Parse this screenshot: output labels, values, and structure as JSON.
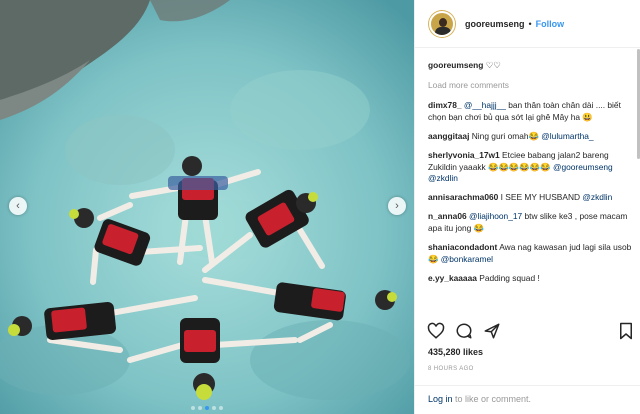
{
  "post": {
    "username": "gooreumseng",
    "follow_label": "Follow",
    "separator": "•",
    "caption_text": "♡♡",
    "load_more": "Load more comments",
    "comments": [
      {
        "user": "dimx78_",
        "parts": [
          {
            "t": " "
          },
          {
            "t": "@__hajjj__",
            "m": true
          },
          {
            "t": " ban thân toàn chân dài .... biết chọn bạn chơi bủ qua sớt lại ghê Mây ha 😃"
          }
        ]
      },
      {
        "user": "aanggitaaj",
        "parts": [
          {
            "t": " Ning guri omah😂 "
          },
          {
            "t": "@lulumartha_",
            "m": true
          }
        ]
      },
      {
        "user": "sherlyvonia_17w1",
        "parts": [
          {
            "t": " Etciee babang jalan2 bareng Zukildin yaaakk 😂😂😂😂😂😂 "
          },
          {
            "t": "@gooreumseng",
            "m": true
          },
          {
            "t": " "
          },
          {
            "t": "@zkdlin",
            "m": true
          }
        ]
      },
      {
        "user": "annisarachma060",
        "parts": [
          {
            "t": " I SEE MY HUSBAND "
          },
          {
            "t": "@zkdlin",
            "m": true
          }
        ]
      },
      {
        "user": "n_anna06",
        "parts": [
          {
            "t": " "
          },
          {
            "t": "@liajihoon_17",
            "m": true
          },
          {
            "t": " btw slike ke3 , pose macam apa itu jong 😂"
          }
        ]
      },
      {
        "user": "shaniacondadont",
        "parts": [
          {
            "t": " Awa nag kawasan jud lagi sila usob 😂 "
          },
          {
            "t": "@bonkaramel",
            "m": true
          }
        ]
      },
      {
        "user": "e.yy_kaaaaa",
        "parts": [
          {
            "t": " Padding squad !"
          }
        ]
      }
    ],
    "likes": "435,280 likes",
    "timestamp": "8 HOURS AGO",
    "login_link": "Log in",
    "login_rest": " to like or comment.",
    "icons": [
      "heart-icon",
      "comment-icon",
      "share-icon",
      "bookmark-icon",
      "chevron-left-icon",
      "chevron-right-icon"
    ],
    "carousel": {
      "count": 5,
      "active": 2
    },
    "colors": {
      "link": "#003569",
      "follow": "#3897f0",
      "water": "#7fc3c6",
      "vest": "#c8202d"
    }
  }
}
